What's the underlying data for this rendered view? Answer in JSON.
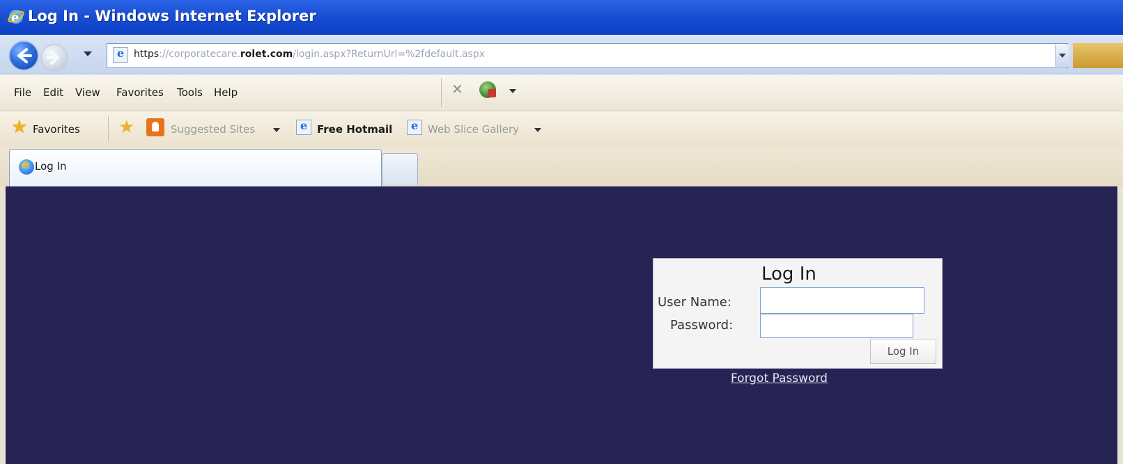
{
  "window": {
    "title": "Log In - Windows Internet Explorer",
    "title_icon": "ie-logo-icon"
  },
  "address_bar": {
    "url_scheme": "https",
    "url_sep": "://",
    "url_sub": "corporatecare.",
    "url_domain": "rolet.com",
    "url_path": "/login.aspx?ReturnUrl=%2fdefault.aspx"
  },
  "menu": {
    "items": [
      "File",
      "Edit",
      "View",
      "Favorites",
      "Tools",
      "Help"
    ]
  },
  "favorites_bar": {
    "favorites_label": "Favorites",
    "suggested_label": "Suggested Sites",
    "hotmail_label": "Free Hotmail",
    "webslice_label": "Web Slice Gallery"
  },
  "tabs": [
    {
      "label": "Log In",
      "active": true
    }
  ],
  "login": {
    "title": "Log In",
    "username_label": "User Name:",
    "password_label": "Password:",
    "username_value": "",
    "password_value": "",
    "submit_label": "Log In",
    "forgot_label": "Forgot Password"
  },
  "colors": {
    "page_background": "#282355",
    "titlebar": "#1b4fd2",
    "login_box": "#f4f4f4"
  }
}
